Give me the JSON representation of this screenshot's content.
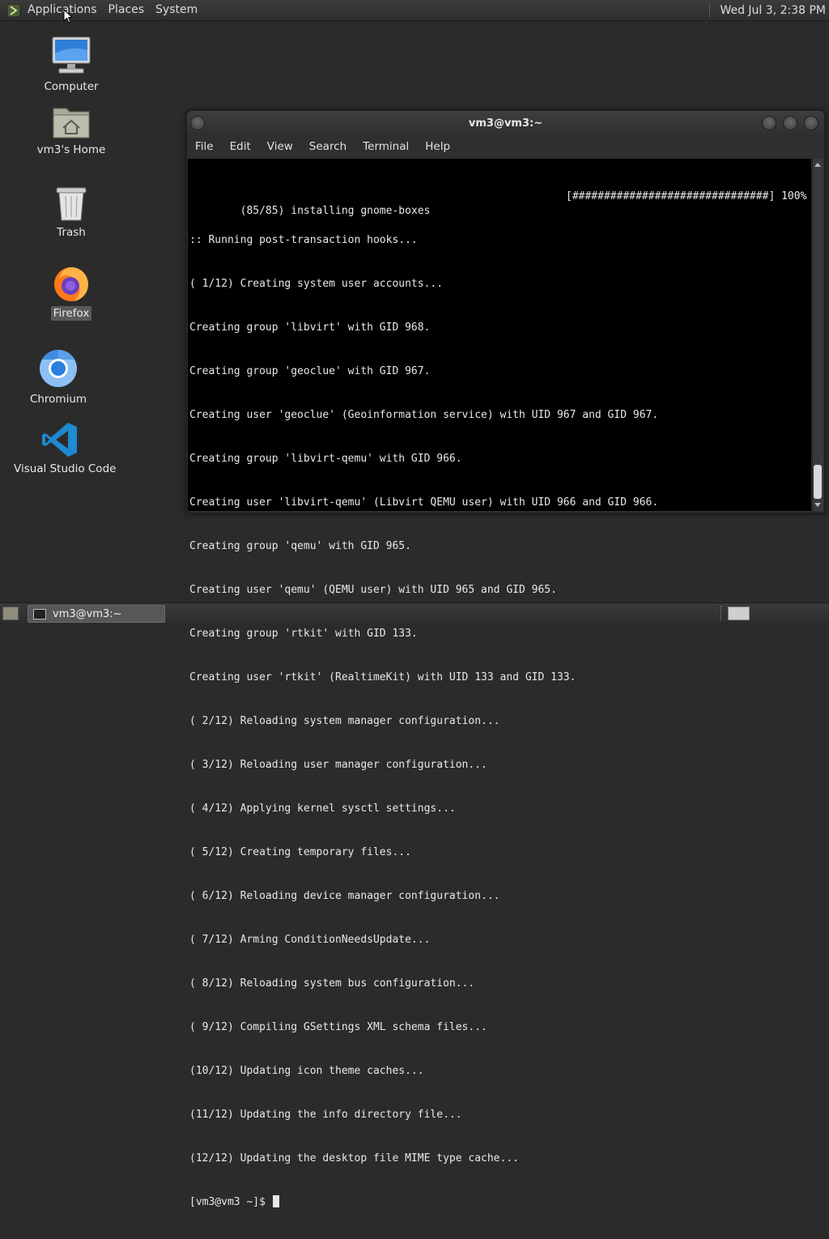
{
  "top_panel": {
    "menus": [
      "Applications",
      "Places",
      "System"
    ],
    "clock": "Wed Jul  3,  2:38 PM"
  },
  "desktop": {
    "icons": [
      {
        "label": "Computer",
        "icon": "computer-icon"
      },
      {
        "label": "vm3's Home",
        "icon": "home-folder-icon"
      },
      {
        "label": "Trash",
        "icon": "trash-icon"
      },
      {
        "label": "Firefox",
        "icon": "firefox-icon"
      },
      {
        "label": "Chromium",
        "icon": "chromium-icon"
      },
      {
        "label": "Visual Studio Code",
        "icon": "vscode-icon"
      }
    ]
  },
  "terminal": {
    "title": "vm3@vm3:~",
    "menu": [
      "File",
      "Edit",
      "View",
      "Search",
      "Terminal",
      "Help"
    ],
    "progress_text": "[###############################] 100%",
    "lines": [
      "(85/85) installing gnome-boxes",
      ":: Running post-transaction hooks...",
      "( 1/12) Creating system user accounts...",
      "Creating group 'libvirt' with GID 968.",
      "Creating group 'geoclue' with GID 967.",
      "Creating user 'geoclue' (Geoinformation service) with UID 967 and GID 967.",
      "Creating group 'libvirt-qemu' with GID 966.",
      "Creating user 'libvirt-qemu' (Libvirt QEMU user) with UID 966 and GID 966.",
      "Creating group 'qemu' with GID 965.",
      "Creating user 'qemu' (QEMU user) with UID 965 and GID 965.",
      "Creating group 'rtkit' with GID 133.",
      "Creating user 'rtkit' (RealtimeKit) with UID 133 and GID 133.",
      "( 2/12) Reloading system manager configuration...",
      "( 3/12) Reloading user manager configuration...",
      "( 4/12) Applying kernel sysctl settings...",
      "( 5/12) Creating temporary files...",
      "( 6/12) Reloading device manager configuration...",
      "( 7/12) Arming ConditionNeedsUpdate...",
      "( 8/12) Reloading system bus configuration...",
      "( 9/12) Compiling GSettings XML schema files...",
      "(10/12) Updating icon theme caches...",
      "(11/12) Updating the info directory file...",
      "(12/12) Updating the desktop file MIME type cache..."
    ],
    "prompt": "[vm3@vm3 ~]$ "
  },
  "bottom_panel": {
    "task_label": "vm3@vm3:~"
  },
  "colors": {
    "desktop_bg": "#2b2b2b",
    "terminal_bg": "#000000",
    "terminal_fg": "#e8e8e8",
    "vscode_blue": "#1f8ad2",
    "chromium_blue": "#2a7fe0"
  }
}
